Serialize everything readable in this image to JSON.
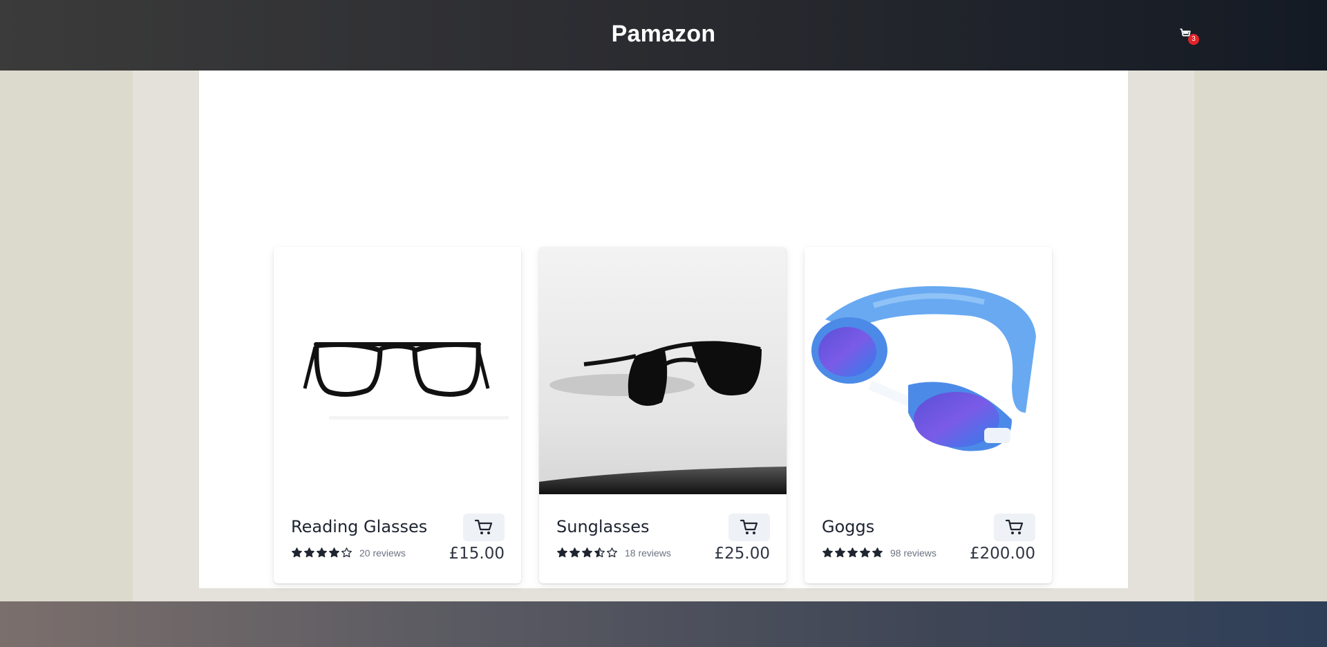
{
  "header": {
    "brand": "Pamazon",
    "cart_icon": "cart-icon",
    "cart_count": "3"
  },
  "products": [
    {
      "title": "Reading Glasses",
      "rating": 4,
      "reviews": "20 reviews",
      "price": "£15.00",
      "image": "reading-glasses-image"
    },
    {
      "title": "Sunglasses",
      "rating": 3.5,
      "reviews": "18 reviews",
      "price": "£25.00",
      "image": "sunglasses-image"
    },
    {
      "title": "Goggs",
      "rating": 5,
      "reviews": "98 reviews",
      "price": "£200.00",
      "image": "swim-goggles-image"
    }
  ],
  "colors": {
    "header_dark": "#1b1f27",
    "badge": "#e0242b",
    "button_bg": "#eef1f5",
    "text_dark": "#1e2430"
  }
}
